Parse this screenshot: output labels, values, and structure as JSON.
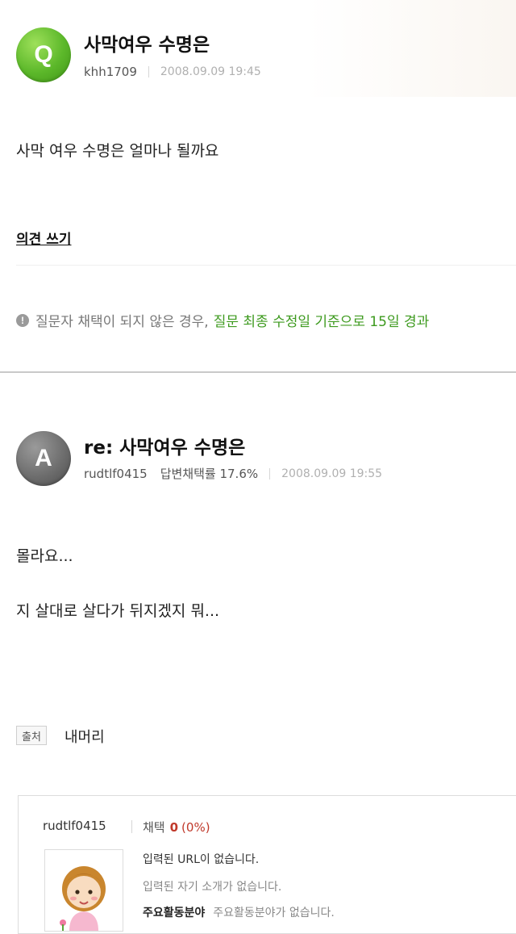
{
  "question": {
    "badge": "Q",
    "title": "사막여우 수명은",
    "author": "khh1709",
    "date": "2008.09.09 19:45",
    "body": "사막 여우 수명은 얼마나 될까요",
    "opinion_link": "의견 쓰기",
    "notice_gray": "질문자 채택이 되지 않은 경우,",
    "notice_green": "질문 최종 수정일 기준으로 15일 경과",
    "notice_icon": "exclamation-icon"
  },
  "answer": {
    "badge": "A",
    "title": "re: 사막여우 수명은",
    "author": "rudtlf0415",
    "adoption_rate": "답변채택률 17.6%",
    "date": "2008.09.09 19:55",
    "body_line1": "몰라요...",
    "body_line2": "지 살대로 살다가 뒤지겠지 뭐...",
    "source_label": "출처",
    "source_value": "내머리"
  },
  "profile": {
    "name": "rudtlf0415",
    "adopt_label": "채택",
    "adopt_count": "0",
    "adopt_pct": "(0%)",
    "url_line": "입력된 URL이 없습니다.",
    "intro_line": "입력된 자기 소개가 없습니다.",
    "field_label": "주요활동분야",
    "field_value": "주요활동분야가 없습니다."
  },
  "colors": {
    "green_accent": "#3d9a1e",
    "q_badge": "#5cb82a",
    "a_badge": "#6e6e6e",
    "adopt_red": "#c0392b"
  }
}
